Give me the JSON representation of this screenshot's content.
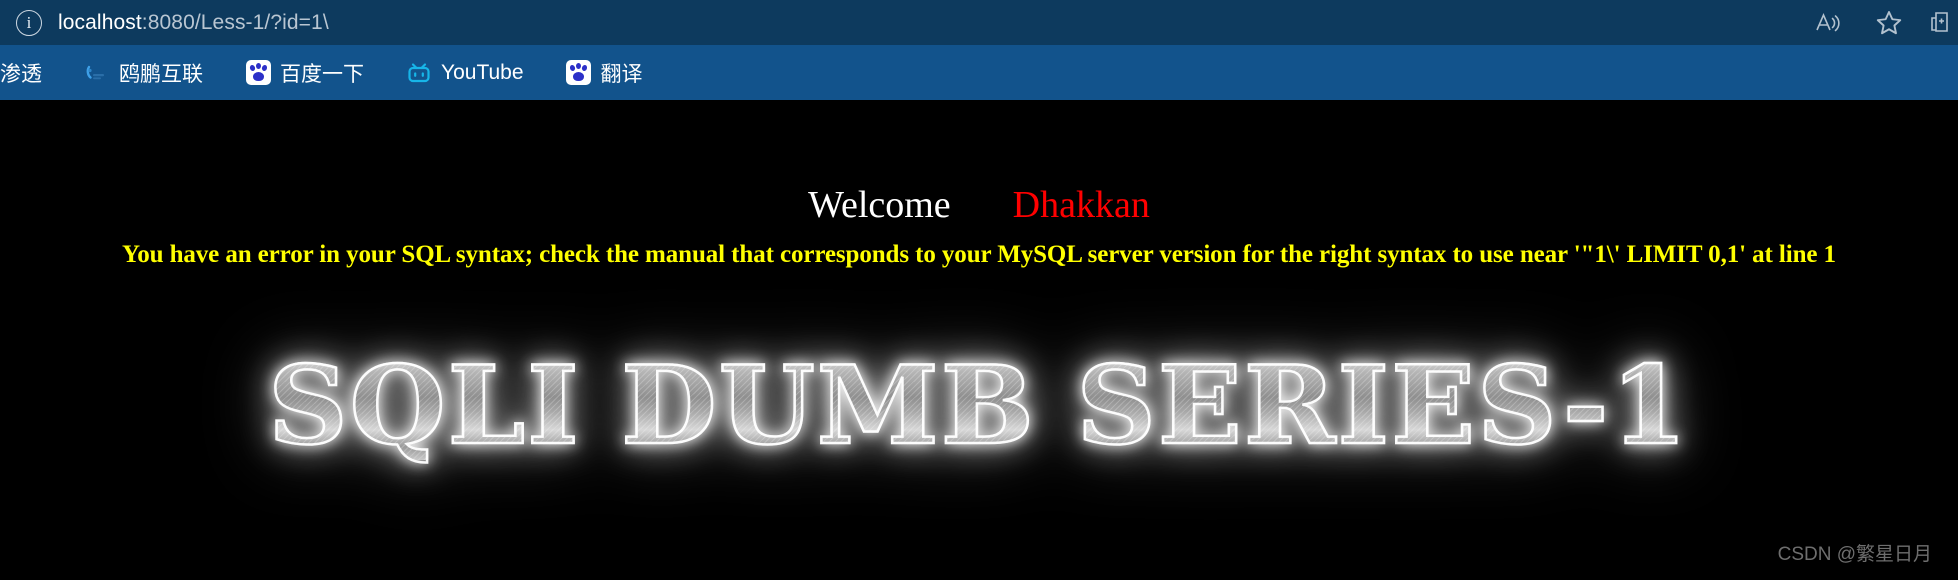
{
  "browser": {
    "address_bar": {
      "info_icon": "info-circle-icon",
      "host": "localhost",
      "path": ":8080/Less-1/?id=1\\",
      "full_url": "localhost:8080/Less-1/?id=1\\"
    },
    "toolbar_buttons": [
      {
        "name": "read-aloud-button",
        "icon": "read-aloud-icon"
      },
      {
        "name": "favorites-button",
        "icon": "star-icon"
      },
      {
        "name": "collections-button",
        "icon": "collections-icon"
      }
    ],
    "bookmarks": [
      {
        "label": "渗透",
        "icon": "generic-bookmark-icon"
      },
      {
        "label": "鸥鹏互联",
        "icon": "oupeng-icon"
      },
      {
        "label": "百度一下",
        "icon": "baidu-paw-icon"
      },
      {
        "label": "YouTube",
        "icon": "tv-icon"
      },
      {
        "label": "翻译",
        "icon": "baidu-paw-icon"
      }
    ]
  },
  "page": {
    "welcome_text": "Welcome",
    "user_name": "Dhakkan",
    "sql_error": "You have an error in your SQL syntax; check the manual that corresponds to your MySQL server version for the right syntax to use near '\"1\\' LIMIT 0,1' at line 1",
    "logo_text": "SQLI DUMB SERIES-1",
    "watermark": "CSDN @繁星日月"
  },
  "colors": {
    "toolbar_bg": "#0d3a5e",
    "bookmarks_bg": "#12538c",
    "page_bg": "#000000",
    "welcome_color": "#ffffff",
    "user_color": "#ff0000",
    "error_color": "#ffff00"
  }
}
